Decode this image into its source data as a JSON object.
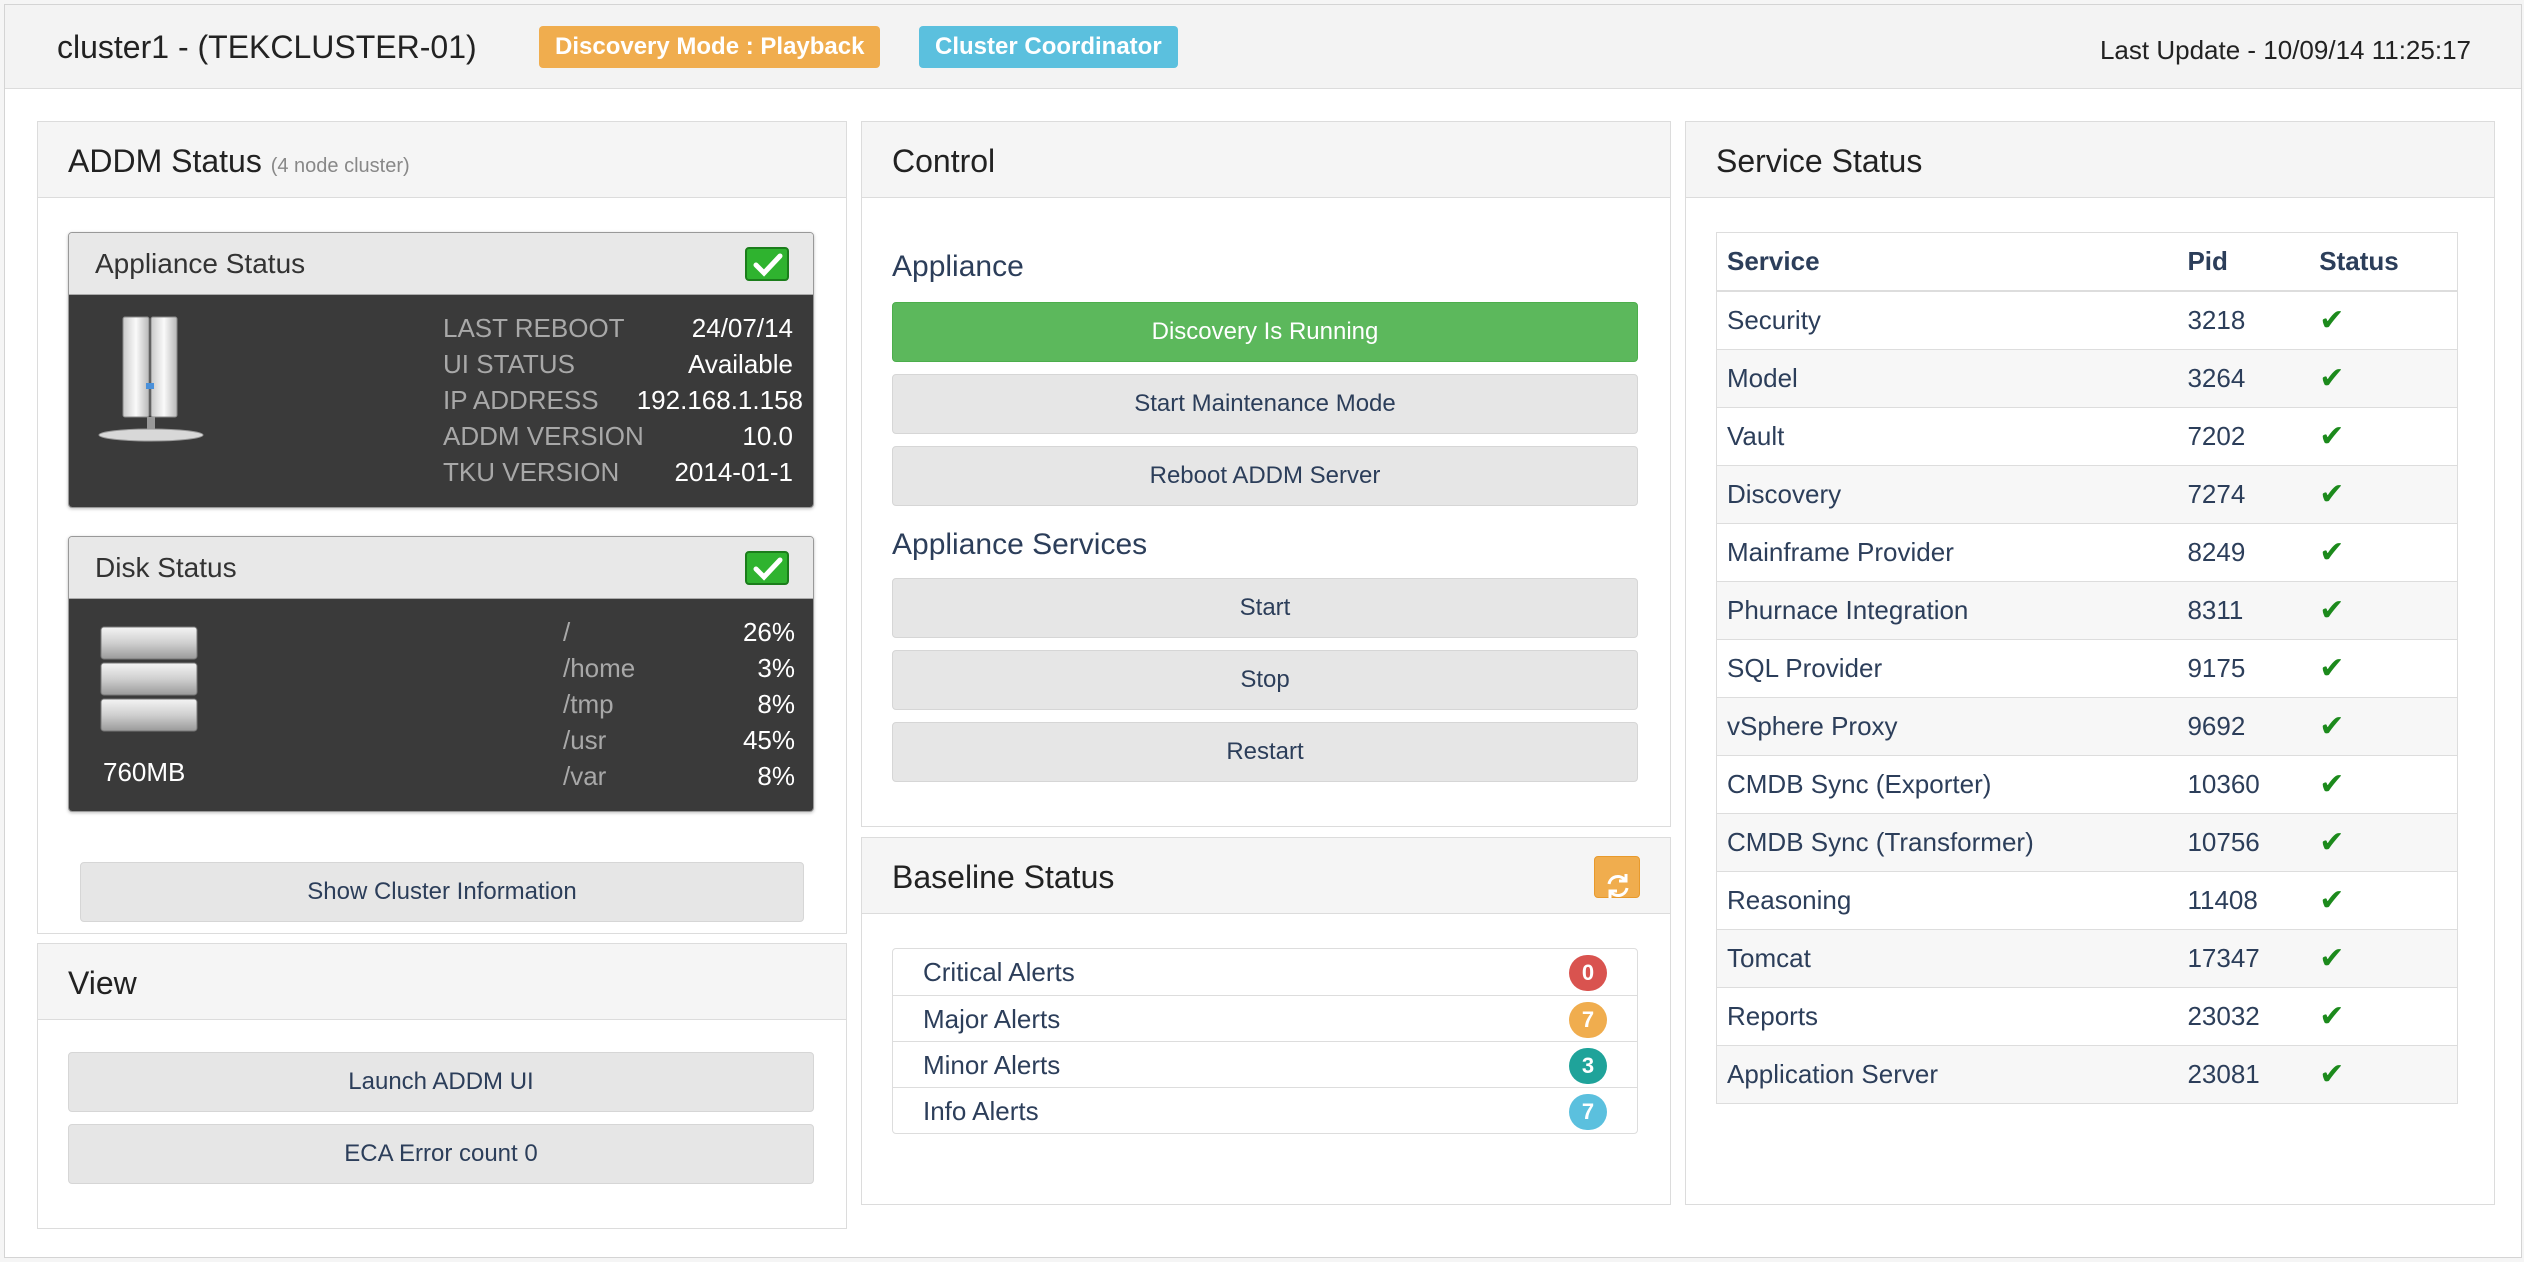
{
  "header": {
    "title": "cluster1 - (TEKCLUSTER-01)",
    "mode_badge": "Discovery Mode : Playback",
    "coord_badge": "Cluster Coordinator",
    "last_update": "Last Update - 10/09/14 11:25:17"
  },
  "addm_status": {
    "title": "ADDM Status",
    "subtitle": "(4 node cluster)",
    "appliance": {
      "title": "Appliance Status",
      "rows": [
        {
          "key": "LAST REBOOT",
          "value": "24/07/14"
        },
        {
          "key": "UI STATUS",
          "value": "Available"
        },
        {
          "key": "IP ADDRESS",
          "value": "192.168.1.158"
        },
        {
          "key": "ADDM VERSION",
          "value": "10.0"
        },
        {
          "key": "TKU VERSION",
          "value": "2014-01-1"
        }
      ]
    },
    "disk": {
      "title": "Disk Status",
      "size": "760MB",
      "rows": [
        {
          "key": "/",
          "value": "26%"
        },
        {
          "key": "/home",
          "value": "3%"
        },
        {
          "key": "/tmp",
          "value": "8%"
        },
        {
          "key": "/usr",
          "value": "45%"
        },
        {
          "key": "/var",
          "value": "8%"
        }
      ]
    },
    "show_cluster_button": "Show Cluster Information"
  },
  "view": {
    "title": "View",
    "launch_button": "Launch ADDM UI",
    "eca_button": "ECA Error count 0"
  },
  "control": {
    "title": "Control",
    "appliance_label": "Appliance",
    "discovery_button": "Discovery Is Running",
    "maintenance_button": "Start Maintenance Mode",
    "reboot_button": "Reboot ADDM Server",
    "services_label": "Appliance Services",
    "start_button": "Start",
    "stop_button": "Stop",
    "restart_button": "Restart"
  },
  "baseline": {
    "title": "Baseline Status",
    "alerts": [
      {
        "label": "Critical Alerts",
        "count": "0",
        "color": "#d9534f"
      },
      {
        "label": "Major Alerts",
        "count": "7",
        "color": "#f0ad4e"
      },
      {
        "label": "Minor Alerts",
        "count": "3",
        "color": "#1fa39a"
      },
      {
        "label": "Info Alerts",
        "count": "7",
        "color": "#5bc0de"
      }
    ]
  },
  "service_status": {
    "title": "Service Status",
    "columns": [
      "Service",
      "Pid",
      "Status"
    ],
    "rows": [
      {
        "service": "Security",
        "pid": "3218",
        "status": "✔"
      },
      {
        "service": "Model",
        "pid": "3264",
        "status": "✔"
      },
      {
        "service": "Vault",
        "pid": "7202",
        "status": "✔"
      },
      {
        "service": "Discovery",
        "pid": "7274",
        "status": "✔"
      },
      {
        "service": "Mainframe Provider",
        "pid": "8249",
        "status": "✔"
      },
      {
        "service": "Phurnace Integration",
        "pid": "8311",
        "status": "✔"
      },
      {
        "service": "SQL Provider",
        "pid": "9175",
        "status": "✔"
      },
      {
        "service": "vSphere Proxy",
        "pid": "9692",
        "status": "✔"
      },
      {
        "service": "CMDB Sync (Exporter)",
        "pid": "10360",
        "status": "✔"
      },
      {
        "service": "CMDB Sync (Transformer)",
        "pid": "10756",
        "status": "✔"
      },
      {
        "service": "Reasoning",
        "pid": "11408",
        "status": "✔"
      },
      {
        "service": "Tomcat",
        "pid": "17347",
        "status": "✔"
      },
      {
        "service": "Reports",
        "pid": "23032",
        "status": "✔"
      },
      {
        "service": "Application Server",
        "pid": "23081",
        "status": "✔"
      }
    ]
  },
  "icons": {
    "server": "server-icon",
    "disk": "disk-stack-icon",
    "ok": "check-icon",
    "refresh": "refresh-icon"
  }
}
